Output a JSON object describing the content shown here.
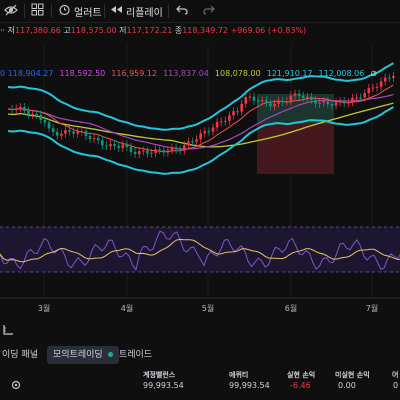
{
  "toolbar": {
    "alert_label": "얼러트",
    "replay_label": "리플레이",
    "icons": [
      "eye-off-icon",
      "grid-icon",
      "alarm-clock-icon",
      "replay-icon",
      "undo-icon",
      "redo-icon"
    ]
  },
  "ohlc": {
    "low_prefix": "저",
    "low_value": "117,380.66",
    "high_prefix": "고",
    "high_value": "118,575.00",
    "close_prefix": "저",
    "close_value": "117,172.21",
    "last_prefix": "종",
    "last_value": "118,349.72",
    "change": "+969.06 (+0.83%)"
  },
  "ma_values": [
    {
      "value": "118,904.27",
      "color": "#2962ff"
    },
    {
      "value": "118,592.50",
      "color": "#e040fb"
    },
    {
      "value": "116,959.12",
      "color": "#ef5350"
    },
    {
      "value": "113,837.04",
      "color": "#ab47bc"
    },
    {
      "value": "108,078.00",
      "color": "#c0ca33"
    },
    {
      "value": "121,910.17",
      "color": "#26c6da"
    },
    {
      "value": "112,008.06",
      "color": "#26c6da"
    }
  ],
  "ma_hidden_icon": "eye-off-icon",
  "time_axis": [
    "3월",
    "4월",
    "5월",
    "6월",
    "7월"
  ],
  "colors": {
    "up": "#f23645",
    "down": "#089981",
    "band": "#26c6da",
    "rsi_line": "#7e57c2",
    "rsi_ma": "#e6c46a",
    "position_box": "#5c1f24"
  },
  "bottom_tabs": {
    "trading_panel": "이딩 패널",
    "paper_trading": "모의트레이딩",
    "trade": "트레이드"
  },
  "stats": {
    "account_balance_label": "계정밸런스",
    "account_balance_value": "99,993.54",
    "equity_label": "에퀴티",
    "equity_value": "99,993.54",
    "realized_pnl_label": "실현 손익",
    "realized_pnl_value": "-6.46",
    "unrealized_pnl_label": "미실현 손익",
    "unrealized_pnl_value": "0.00",
    "cut_label": "어",
    "cut_value": "0"
  }
}
